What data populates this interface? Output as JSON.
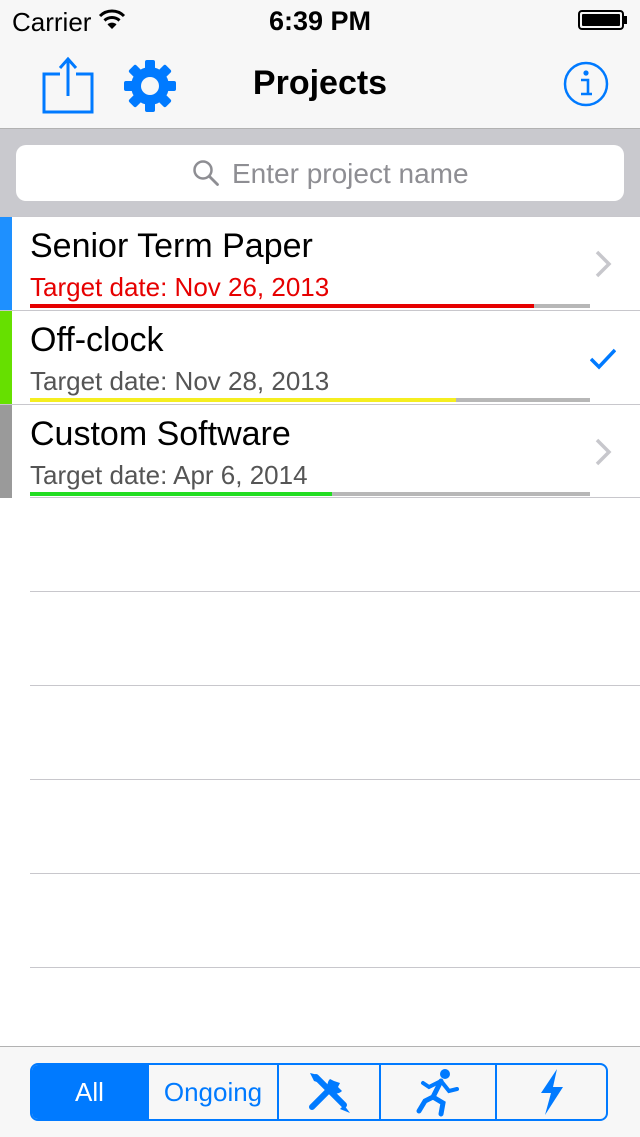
{
  "status_bar": {
    "carrier": "Carrier",
    "time": "6:39 PM"
  },
  "nav": {
    "title": "Projects",
    "left_icons": [
      "share-icon",
      "gear-icon"
    ],
    "right_icon": "info-icon"
  },
  "search": {
    "placeholder": "Enter project name",
    "value": ""
  },
  "projects": [
    {
      "name": "Senior Term Paper",
      "date": "Target date: Nov 26, 2013",
      "strip_color": "#1e90ff",
      "date_color": "#e60000",
      "progress": 0.9,
      "progress_color": "#e60000",
      "accessory": "chevron-right-icon"
    },
    {
      "name": "Off-clock",
      "date": "Target date: Nov 28, 2013",
      "strip_color": "#66e000",
      "date_color": "#555555",
      "progress": 0.76,
      "progress_color": "#f5ee20",
      "accessory": "checkmark-icon"
    },
    {
      "name": "Custom Software",
      "date": "Target date: Apr 6, 2014",
      "strip_color": "#9a9a9a",
      "date_color": "#555555",
      "progress": 0.54,
      "progress_color": "#22dd22",
      "accessory": "chevron-right-icon"
    }
  ],
  "filter": {
    "all_label": "All",
    "ongoing_label": "Ongoing",
    "icon_segments": [
      "tools-icon",
      "running-man-icon",
      "lightning-icon"
    ],
    "selected": "All",
    "accent": "#007aff"
  }
}
